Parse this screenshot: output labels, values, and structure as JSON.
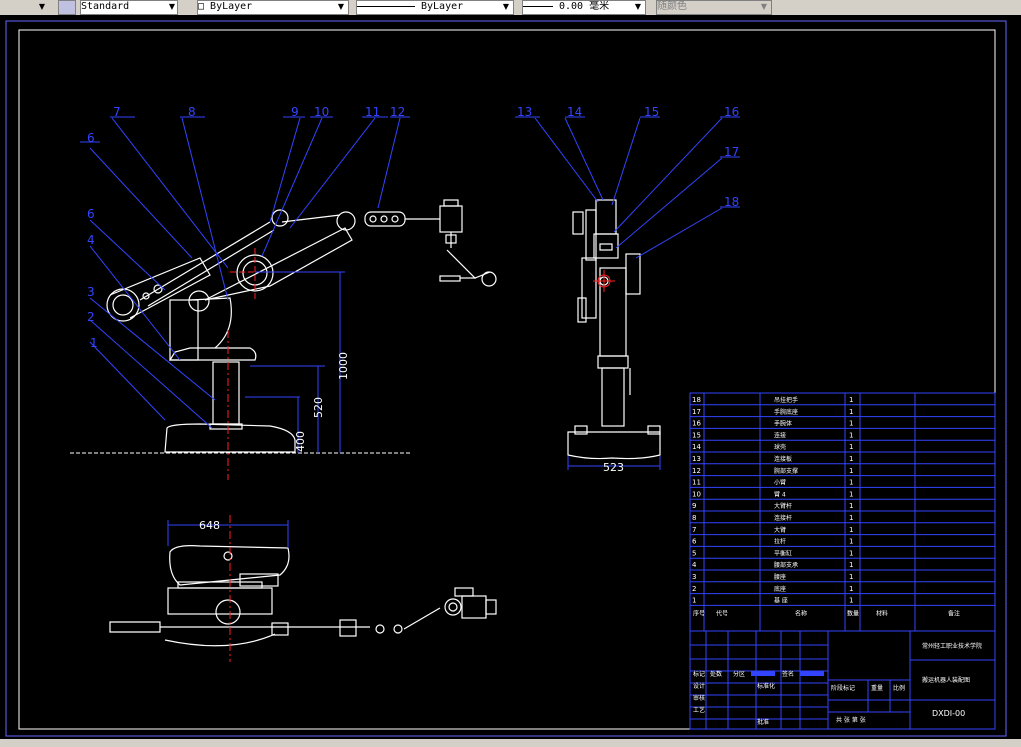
{
  "toolbar": {
    "text_style": "Standard",
    "color": "ByLayer",
    "linetype": "ByLayer",
    "lineweight": "0.00 毫米",
    "plotstyle": "随颜色"
  },
  "callouts": [
    "1",
    "2",
    "3",
    "4",
    "5",
    "6",
    "7",
    "8",
    "9",
    "10",
    "11",
    "12",
    "13",
    "14",
    "15",
    "16",
    "17",
    "18"
  ],
  "dimensions": {
    "height_1000": "1000",
    "height_520": "520",
    "height_400": "400",
    "width_523": "523",
    "width_648": "648"
  },
  "bom": [
    {
      "no": "18",
      "name": "吊挂把手",
      "qty": "1"
    },
    {
      "no": "17",
      "name": "手腕底座",
      "qty": "1"
    },
    {
      "no": "16",
      "name": "手腕体",
      "qty": "1"
    },
    {
      "no": "15",
      "name": "连接",
      "qty": "1"
    },
    {
      "no": "14",
      "name": "球壳",
      "qty": "1"
    },
    {
      "no": "13",
      "name": "连接板",
      "qty": "1"
    },
    {
      "no": "12",
      "name": "腕部支撑",
      "qty": "1"
    },
    {
      "no": "11",
      "name": "小臂",
      "qty": "1"
    },
    {
      "no": "10",
      "name": "臂 4",
      "qty": "1"
    },
    {
      "no": "9",
      "name": "大臂杆",
      "qty": "1"
    },
    {
      "no": "8",
      "name": "连接杆",
      "qty": "1"
    },
    {
      "no": "7",
      "name": "大臂",
      "qty": "1"
    },
    {
      "no": "6",
      "name": "拉杆",
      "qty": "1"
    },
    {
      "no": "5",
      "name": "平衡缸",
      "qty": "1"
    },
    {
      "no": "4",
      "name": "腰部支承",
      "qty": "1"
    },
    {
      "no": "3",
      "name": "腰座",
      "qty": "1"
    },
    {
      "no": "2",
      "name": "底座",
      "qty": "1"
    },
    {
      "no": "1",
      "name": "基 座",
      "qty": "1"
    }
  ],
  "bom_header": {
    "no": "序号",
    "code": "代号",
    "name": "名称",
    "qty": "数量",
    "material": "材料",
    "note": "备注"
  },
  "title_block": {
    "company": "常州轻工职业技术学院",
    "title": "搬运机器人装配图",
    "drawing_no": "DXDI-00",
    "labels": [
      "标记",
      "处数",
      "分区",
      "更改文件号",
      "签名",
      "年月日",
      "设计",
      "标准化",
      "审核",
      "工艺",
      "批准",
      "阶段标记",
      "重量",
      "比例",
      "共 张 第 张"
    ]
  },
  "colors": {
    "background": "#000000",
    "linework": "#ffffff",
    "callout_lines": "#3344ff",
    "dimension": "#3344ff",
    "centerline": "#ff2020",
    "frame": "#ffffff"
  }
}
